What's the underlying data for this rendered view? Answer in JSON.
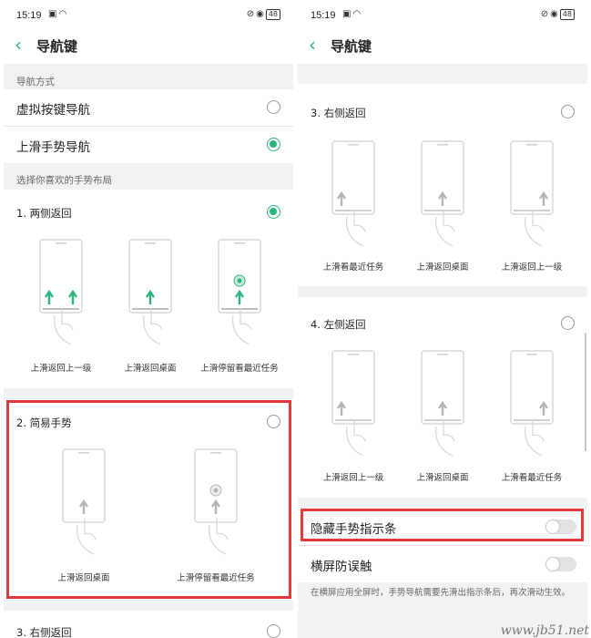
{
  "status_bar": {
    "time": "15:19",
    "icons_left": [
      "notification-icon",
      "wifi-icon"
    ],
    "icons_right": [
      "vibrate-icon",
      "alarm-icon",
      "battery-icon"
    ],
    "battery": "48"
  },
  "header": {
    "title": "导航键"
  },
  "left_panel": {
    "section_nav_mode": "导航方式",
    "nav_options": [
      {
        "label": "虚拟按键导航",
        "selected": false
      },
      {
        "label": "上滑手势导航",
        "selected": true
      }
    ],
    "section_layout": "选择你喜欢的手势布局",
    "layouts": [
      {
        "title": "1. 两侧返回",
        "selected": true,
        "captions": [
          "上滑返回上一级",
          "上滑返回桌面",
          "上滑停留看最近任务"
        ]
      },
      {
        "title": "2. 简易手势",
        "selected": false,
        "captions": [
          "上滑返回桌面",
          "上滑停留看最近任务"
        ]
      },
      {
        "title": "3. 右侧返回",
        "selected": false
      }
    ]
  },
  "right_panel": {
    "layouts": [
      {
        "title": "3. 右侧返回",
        "selected": false,
        "captions": [
          "上滑看最近任务",
          "上滑返回桌面",
          "上滑返回上一级"
        ]
      },
      {
        "title": "4. 左侧返回",
        "selected": false,
        "captions": [
          "上滑返回上一级",
          "上滑返回桌面",
          "上滑看最近任务"
        ]
      }
    ],
    "settings": [
      {
        "label": "隐藏手势指示条",
        "enabled": false
      },
      {
        "label": "横屏防误触",
        "enabled": false
      }
    ],
    "note": "在横屏应用全屏时，手势导航需要先滑出指示条后，再次滑动生效。"
  },
  "watermark": "www.jb51.net",
  "colors": {
    "accent": "#2db37c",
    "highlight": "#e03a3a",
    "bg": "#f2f2f2"
  }
}
